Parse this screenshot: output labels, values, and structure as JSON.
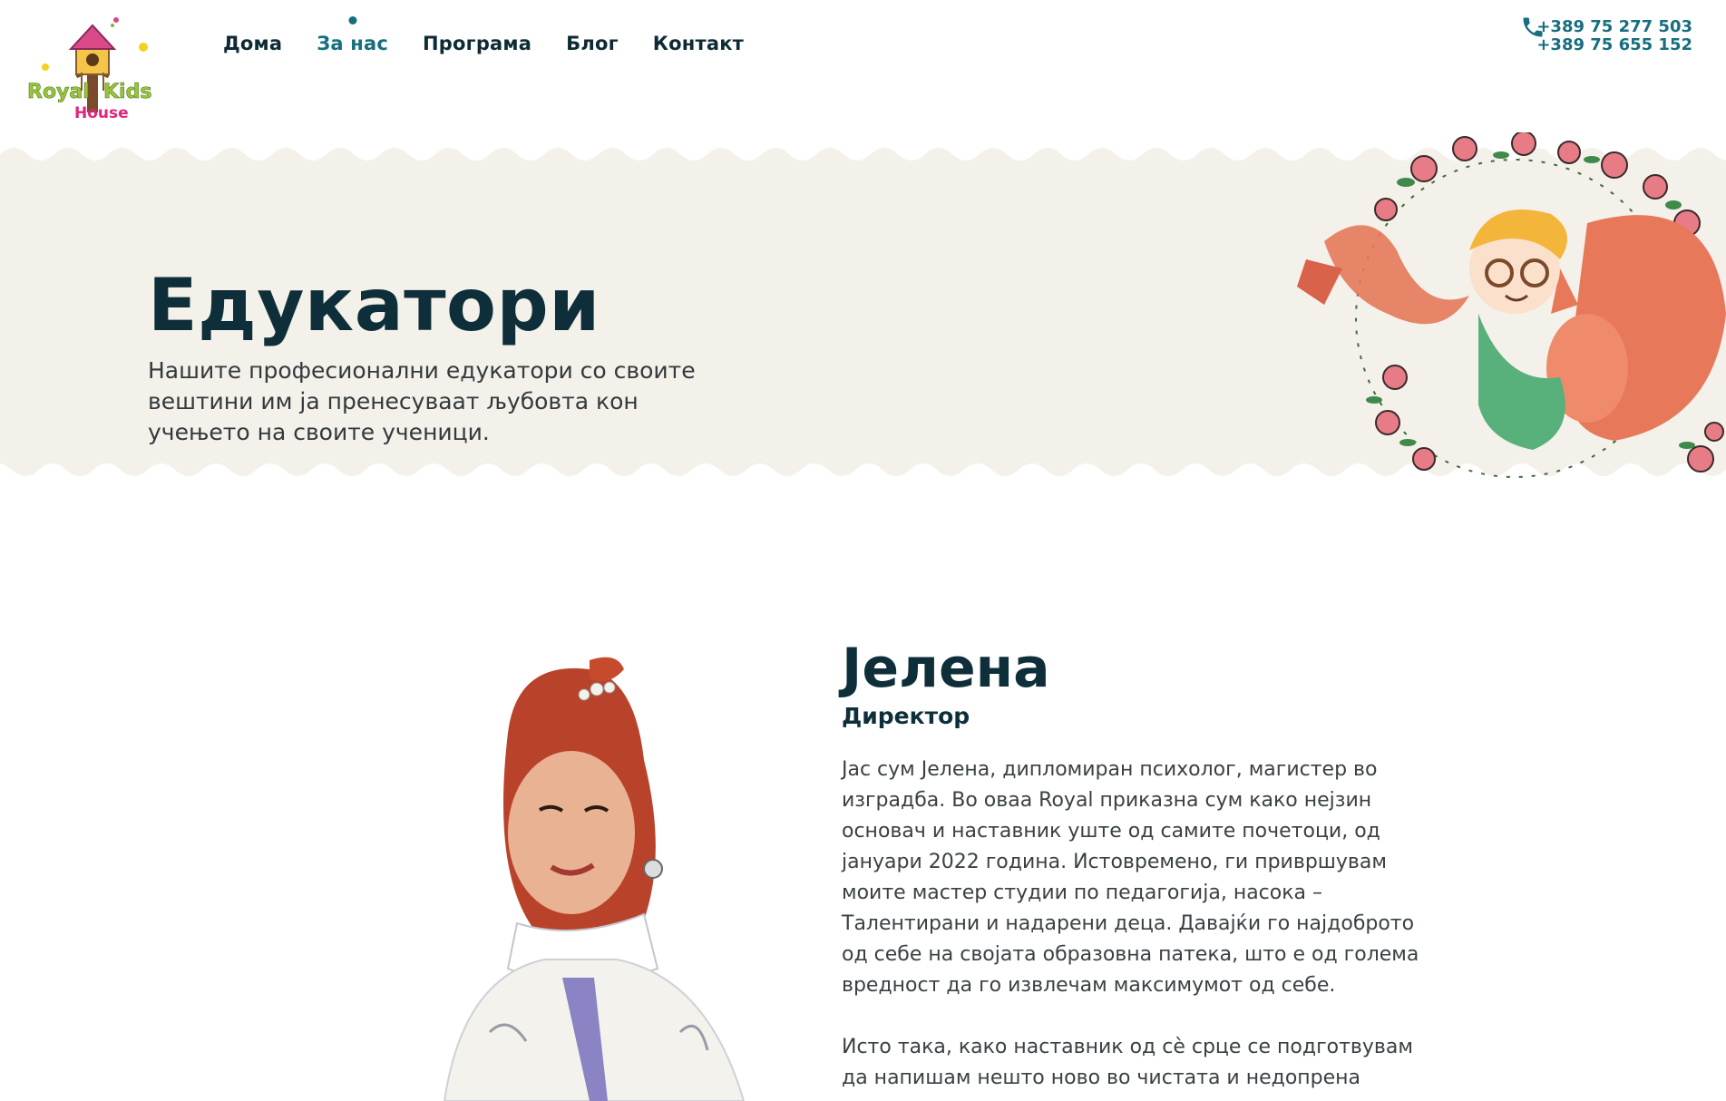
{
  "brand": {
    "name_line1_a": "Royal",
    "name_line1_b": "Kids",
    "name_line2": "House"
  },
  "nav": {
    "items": [
      {
        "label": "Дома"
      },
      {
        "label": "За нас"
      },
      {
        "label": "Програма"
      },
      {
        "label": "Блог"
      },
      {
        "label": "Контакт"
      }
    ],
    "active_index": 1
  },
  "contact": {
    "phone_icon": "phone-icon",
    "phone_1": "+389 75 277 503",
    "phone_2": "+389 75 655 152"
  },
  "hero": {
    "title": "Едукатори",
    "subtitle": "Нашите професионални едукатори со своите вештини им ја пренесуваат љубовта кон учењето на своите ученици."
  },
  "profile": {
    "name": "Јелена",
    "role": "Директор",
    "bio_1": "Јас сум Јелена, дипломиран психолог, магистер во изградба. Во оваа Royal приказна сум како нејзин основач и наставник уште од самите почетоци, од јануари 2022 година. Истовремено, ги привршувам моите мастер студии по педагогија, насока – Талентирани и надарени деца. Давајќи го најдоброто од себе на својата образовна патека, што е од голема вредност да го извлечам максимумот од себе.",
    "bio_2": "Исто така, како наставник од сè срце се подготвувам да напишам нешто ново во чистата и недопрена"
  },
  "colors": {
    "dark": "#0e2f3a",
    "accent": "#176e7e",
    "hero_bg": "#f3f1ea"
  }
}
